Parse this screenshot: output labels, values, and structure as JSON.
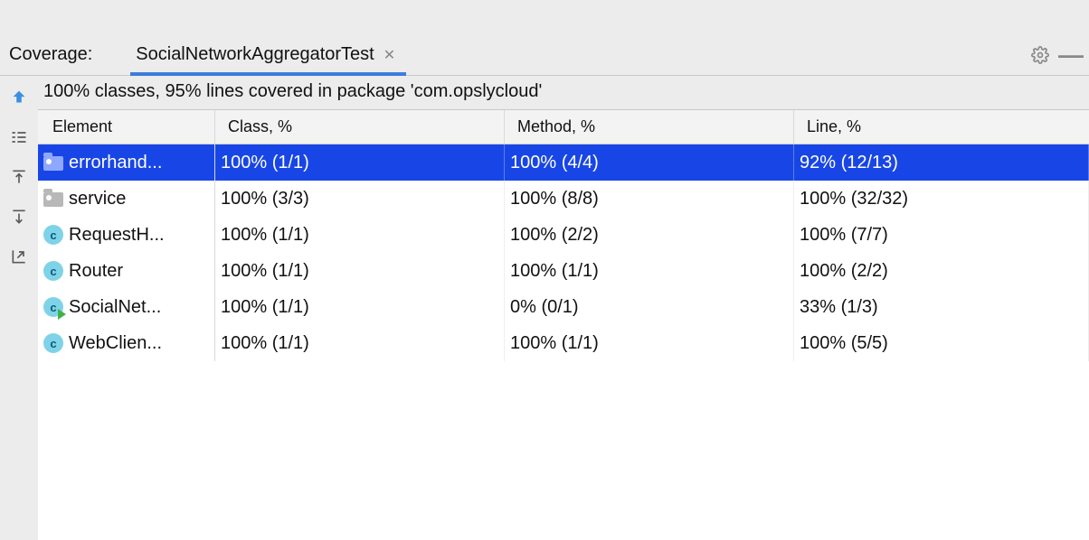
{
  "header": {
    "title": "Coverage:",
    "tab_name": "SocialNetworkAggregatorTest"
  },
  "summary": "100% classes, 95% lines covered in package 'com.opslycloud'",
  "columns": {
    "element": "Element",
    "class": "Class, %",
    "method": "Method, %",
    "line": "Line, %"
  },
  "rows": [
    {
      "icon": "folder",
      "name": "errorhand...",
      "class": "100% (1/1)",
      "method": "100% (4/4)",
      "line": "92% (12/13)",
      "selected": true
    },
    {
      "icon": "folder",
      "name": "service",
      "class": "100% (3/3)",
      "method": "100% (8/8)",
      "line": "100% (32/32)",
      "selected": false
    },
    {
      "icon": "class",
      "name": "RequestH...",
      "class": "100% (1/1)",
      "method": "100% (2/2)",
      "line": "100% (7/7)",
      "selected": false
    },
    {
      "icon": "class",
      "name": "Router",
      "class": "100% (1/1)",
      "method": "100% (1/1)",
      "line": "100% (2/2)",
      "selected": false
    },
    {
      "icon": "class-run",
      "name": "SocialNet...",
      "class": "100% (1/1)",
      "method": "0% (0/1)",
      "line": "33% (1/3)",
      "selected": false
    },
    {
      "icon": "class",
      "name": "WebClien...",
      "class": "100% (1/1)",
      "method": "100% (1/1)",
      "line": "100% (5/5)",
      "selected": false
    }
  ]
}
